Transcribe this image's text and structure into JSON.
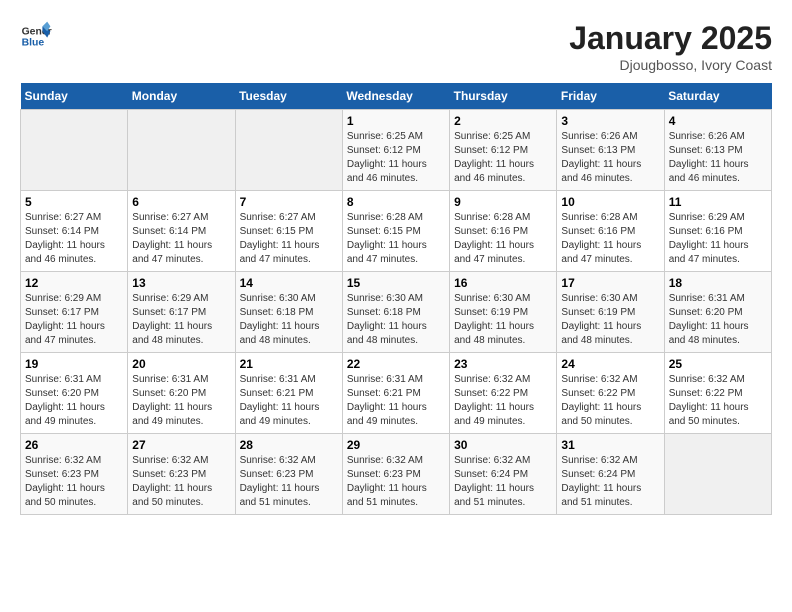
{
  "header": {
    "logo_line1": "General",
    "logo_line2": "Blue",
    "month_title": "January 2025",
    "location": "Djougbosso, Ivory Coast"
  },
  "weekdays": [
    "Sunday",
    "Monday",
    "Tuesday",
    "Wednesday",
    "Thursday",
    "Friday",
    "Saturday"
  ],
  "weeks": [
    [
      {
        "day": "",
        "sunrise": "",
        "sunset": "",
        "daylight": ""
      },
      {
        "day": "",
        "sunrise": "",
        "sunset": "",
        "daylight": ""
      },
      {
        "day": "",
        "sunrise": "",
        "sunset": "",
        "daylight": ""
      },
      {
        "day": "1",
        "sunrise": "Sunrise: 6:25 AM",
        "sunset": "Sunset: 6:12 PM",
        "daylight": "Daylight: 11 hours and 46 minutes."
      },
      {
        "day": "2",
        "sunrise": "Sunrise: 6:25 AM",
        "sunset": "Sunset: 6:12 PM",
        "daylight": "Daylight: 11 hours and 46 minutes."
      },
      {
        "day": "3",
        "sunrise": "Sunrise: 6:26 AM",
        "sunset": "Sunset: 6:13 PM",
        "daylight": "Daylight: 11 hours and 46 minutes."
      },
      {
        "day": "4",
        "sunrise": "Sunrise: 6:26 AM",
        "sunset": "Sunset: 6:13 PM",
        "daylight": "Daylight: 11 hours and 46 minutes."
      }
    ],
    [
      {
        "day": "5",
        "sunrise": "Sunrise: 6:27 AM",
        "sunset": "Sunset: 6:14 PM",
        "daylight": "Daylight: 11 hours and 46 minutes."
      },
      {
        "day": "6",
        "sunrise": "Sunrise: 6:27 AM",
        "sunset": "Sunset: 6:14 PM",
        "daylight": "Daylight: 11 hours and 47 minutes."
      },
      {
        "day": "7",
        "sunrise": "Sunrise: 6:27 AM",
        "sunset": "Sunset: 6:15 PM",
        "daylight": "Daylight: 11 hours and 47 minutes."
      },
      {
        "day": "8",
        "sunrise": "Sunrise: 6:28 AM",
        "sunset": "Sunset: 6:15 PM",
        "daylight": "Daylight: 11 hours and 47 minutes."
      },
      {
        "day": "9",
        "sunrise": "Sunrise: 6:28 AM",
        "sunset": "Sunset: 6:16 PM",
        "daylight": "Daylight: 11 hours and 47 minutes."
      },
      {
        "day": "10",
        "sunrise": "Sunrise: 6:28 AM",
        "sunset": "Sunset: 6:16 PM",
        "daylight": "Daylight: 11 hours and 47 minutes."
      },
      {
        "day": "11",
        "sunrise": "Sunrise: 6:29 AM",
        "sunset": "Sunset: 6:16 PM",
        "daylight": "Daylight: 11 hours and 47 minutes."
      }
    ],
    [
      {
        "day": "12",
        "sunrise": "Sunrise: 6:29 AM",
        "sunset": "Sunset: 6:17 PM",
        "daylight": "Daylight: 11 hours and 47 minutes."
      },
      {
        "day": "13",
        "sunrise": "Sunrise: 6:29 AM",
        "sunset": "Sunset: 6:17 PM",
        "daylight": "Daylight: 11 hours and 48 minutes."
      },
      {
        "day": "14",
        "sunrise": "Sunrise: 6:30 AM",
        "sunset": "Sunset: 6:18 PM",
        "daylight": "Daylight: 11 hours and 48 minutes."
      },
      {
        "day": "15",
        "sunrise": "Sunrise: 6:30 AM",
        "sunset": "Sunset: 6:18 PM",
        "daylight": "Daylight: 11 hours and 48 minutes."
      },
      {
        "day": "16",
        "sunrise": "Sunrise: 6:30 AM",
        "sunset": "Sunset: 6:19 PM",
        "daylight": "Daylight: 11 hours and 48 minutes."
      },
      {
        "day": "17",
        "sunrise": "Sunrise: 6:30 AM",
        "sunset": "Sunset: 6:19 PM",
        "daylight": "Daylight: 11 hours and 48 minutes."
      },
      {
        "day": "18",
        "sunrise": "Sunrise: 6:31 AM",
        "sunset": "Sunset: 6:20 PM",
        "daylight": "Daylight: 11 hours and 48 minutes."
      }
    ],
    [
      {
        "day": "19",
        "sunrise": "Sunrise: 6:31 AM",
        "sunset": "Sunset: 6:20 PM",
        "daylight": "Daylight: 11 hours and 49 minutes."
      },
      {
        "day": "20",
        "sunrise": "Sunrise: 6:31 AM",
        "sunset": "Sunset: 6:20 PM",
        "daylight": "Daylight: 11 hours and 49 minutes."
      },
      {
        "day": "21",
        "sunrise": "Sunrise: 6:31 AM",
        "sunset": "Sunset: 6:21 PM",
        "daylight": "Daylight: 11 hours and 49 minutes."
      },
      {
        "day": "22",
        "sunrise": "Sunrise: 6:31 AM",
        "sunset": "Sunset: 6:21 PM",
        "daylight": "Daylight: 11 hours and 49 minutes."
      },
      {
        "day": "23",
        "sunrise": "Sunrise: 6:32 AM",
        "sunset": "Sunset: 6:22 PM",
        "daylight": "Daylight: 11 hours and 49 minutes."
      },
      {
        "day": "24",
        "sunrise": "Sunrise: 6:32 AM",
        "sunset": "Sunset: 6:22 PM",
        "daylight": "Daylight: 11 hours and 50 minutes."
      },
      {
        "day": "25",
        "sunrise": "Sunrise: 6:32 AM",
        "sunset": "Sunset: 6:22 PM",
        "daylight": "Daylight: 11 hours and 50 minutes."
      }
    ],
    [
      {
        "day": "26",
        "sunrise": "Sunrise: 6:32 AM",
        "sunset": "Sunset: 6:23 PM",
        "daylight": "Daylight: 11 hours and 50 minutes."
      },
      {
        "day": "27",
        "sunrise": "Sunrise: 6:32 AM",
        "sunset": "Sunset: 6:23 PM",
        "daylight": "Daylight: 11 hours and 50 minutes."
      },
      {
        "day": "28",
        "sunrise": "Sunrise: 6:32 AM",
        "sunset": "Sunset: 6:23 PM",
        "daylight": "Daylight: 11 hours and 51 minutes."
      },
      {
        "day": "29",
        "sunrise": "Sunrise: 6:32 AM",
        "sunset": "Sunset: 6:23 PM",
        "daylight": "Daylight: 11 hours and 51 minutes."
      },
      {
        "day": "30",
        "sunrise": "Sunrise: 6:32 AM",
        "sunset": "Sunset: 6:24 PM",
        "daylight": "Daylight: 11 hours and 51 minutes."
      },
      {
        "day": "31",
        "sunrise": "Sunrise: 6:32 AM",
        "sunset": "Sunset: 6:24 PM",
        "daylight": "Daylight: 11 hours and 51 minutes."
      },
      {
        "day": "",
        "sunrise": "",
        "sunset": "",
        "daylight": ""
      }
    ]
  ]
}
